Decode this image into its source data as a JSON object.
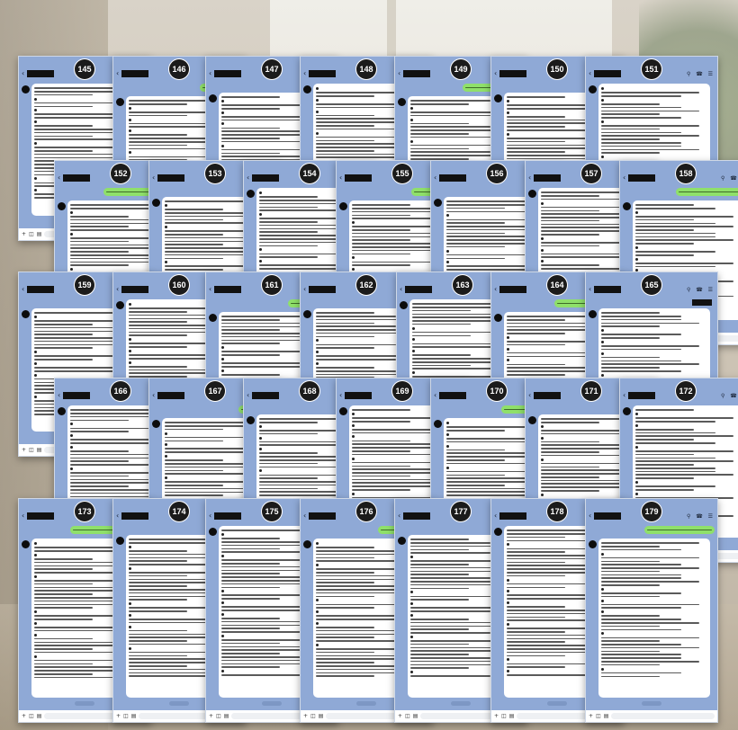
{
  "collage": {
    "description_hidden": "",
    "screenshots": [
      {
        "n": "145"
      },
      {
        "n": "146"
      },
      {
        "n": "147"
      },
      {
        "n": "148"
      },
      {
        "n": "149"
      },
      {
        "n": "150"
      },
      {
        "n": "151"
      },
      {
        "n": "152"
      },
      {
        "n": "153"
      },
      {
        "n": "154"
      },
      {
        "n": "155"
      },
      {
        "n": "156"
      },
      {
        "n": "157"
      },
      {
        "n": "158"
      },
      {
        "n": "159"
      },
      {
        "n": "160"
      },
      {
        "n": "161"
      },
      {
        "n": "162"
      },
      {
        "n": "163"
      },
      {
        "n": "164"
      },
      {
        "n": "165"
      },
      {
        "n": "166"
      },
      {
        "n": "167"
      },
      {
        "n": "168"
      },
      {
        "n": "169"
      },
      {
        "n": "170"
      },
      {
        "n": "171"
      },
      {
        "n": "172"
      },
      {
        "n": "173"
      },
      {
        "n": "174"
      },
      {
        "n": "175"
      },
      {
        "n": "176"
      },
      {
        "n": "177"
      },
      {
        "n": "178"
      },
      {
        "n": "179"
      }
    ]
  },
  "chat_ui": {
    "back_icon": "chevron-left-icon",
    "top_icons": "search-icon phone-icon menu-icon",
    "bottom_icons": "plus-icon camera-icon image-icon",
    "colors": {
      "chat_background": "#8fa9d6",
      "bubble_received": "#ffffff",
      "bubble_sent": "#8fe06a",
      "number_badge": "#1b1b1b",
      "redaction": "#121212"
    }
  }
}
